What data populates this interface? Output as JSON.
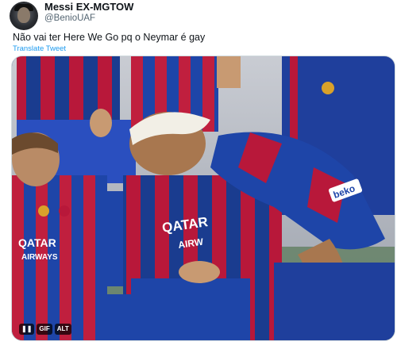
{
  "tweet": {
    "author_name": "Messi EX-MGTOW",
    "author_handle": "@BenioUAF",
    "text": "Não vai ter Here We Go pq o Neymar é gay",
    "translate_label": "Translate Tweet"
  },
  "media": {
    "controls": {
      "pause_icon": "pause-icon",
      "gif_label": "GIF",
      "alt_label": "ALT"
    },
    "shirt_texts": {
      "sponsor_left_1": "QATAR",
      "sponsor_left_2": "AIRWAYS",
      "sponsor_center_1": "QATAR",
      "sponsor_center_2": "AIRW",
      "sleeve": "beko"
    }
  }
}
